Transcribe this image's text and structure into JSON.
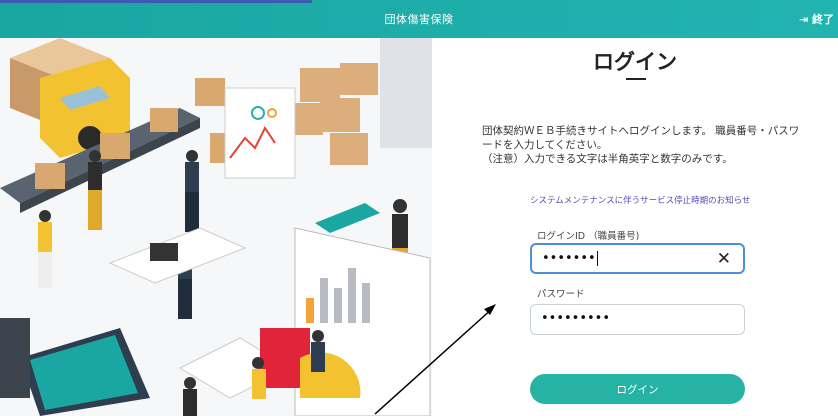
{
  "header": {
    "title": "団体傷害保険",
    "exit_label": "終了"
  },
  "login": {
    "title": "ログイン",
    "description": "団体契約ＷＥＢ手続きサイトへログインします。 職員番号・パスワードを入力してください。",
    "note": "（注意）入力できる文字は半角英字と数字のみです。",
    "maintenance_link": "システムメンテナンスに伴うサービス停止時期のお知らせ",
    "id_label": "ログインID （職員番号)",
    "id_value": "•••••••",
    "password_label": "パスワード",
    "password_value": "•••••••••",
    "button_label": "ログイン"
  },
  "icons": {
    "exit": "logout-icon",
    "clear": "close-icon"
  },
  "colors": {
    "header": "#22b4b0",
    "button": "#26b3a5",
    "link": "#5b48b8",
    "focus": "#4a8fd8"
  }
}
